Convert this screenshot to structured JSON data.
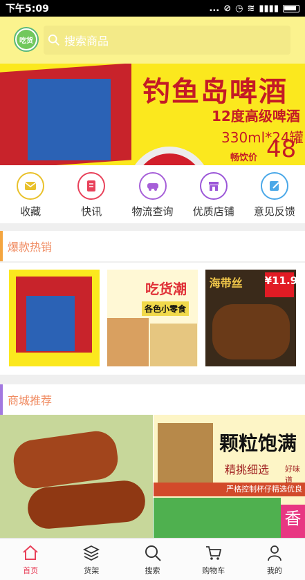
{
  "status_bar": {
    "time": "下午5:09",
    "extras": "..."
  },
  "header": {
    "logo_text": "吃货",
    "search_placeholder": "搜索商品"
  },
  "banner": {
    "title": "钓鱼岛啤酒",
    "subtitle": "12度高级啤酒",
    "spec": "330ml*24罐",
    "price_label": "畅饮价",
    "price": "48"
  },
  "quick_nav": [
    {
      "label": "收藏",
      "icon": "envelope-icon",
      "color": "#e9c12b"
    },
    {
      "label": "快讯",
      "icon": "news-icon",
      "color": "#e8415a"
    },
    {
      "label": "物流查询",
      "icon": "truck-icon",
      "color": "#a65fd8"
    },
    {
      "label": "优质店铺",
      "icon": "store-icon",
      "color": "#9b56d8"
    },
    {
      "label": "意见反馈",
      "icon": "feedback-icon",
      "color": "#4aa8e8"
    }
  ],
  "sections": {
    "hot": {
      "title": "爆款热销",
      "accent": "#f4a540"
    },
    "recommend": {
      "title": "商城推荐",
      "accent": "#a278e0"
    }
  },
  "hot_items": [
    {
      "label": ""
    },
    {
      "tag_main": "吃货潮",
      "tag_sub": "各色小零食"
    },
    {
      "name": "海带丝",
      "price": "¥11.9"
    }
  ],
  "recommend": {
    "headline": "颗粒饱满",
    "sub": "精挑细选",
    "side": "好味道",
    "strip": "严格控制杯仔精选优良",
    "pink": "香"
  },
  "tabs": [
    {
      "label": "首页",
      "icon": "home-icon",
      "active": true
    },
    {
      "label": "货架",
      "icon": "layers-icon",
      "active": false
    },
    {
      "label": "搜索",
      "icon": "search-icon",
      "active": false
    },
    {
      "label": "购物车",
      "icon": "cart-icon",
      "active": false
    },
    {
      "label": "我的",
      "icon": "user-icon",
      "active": false
    }
  ]
}
